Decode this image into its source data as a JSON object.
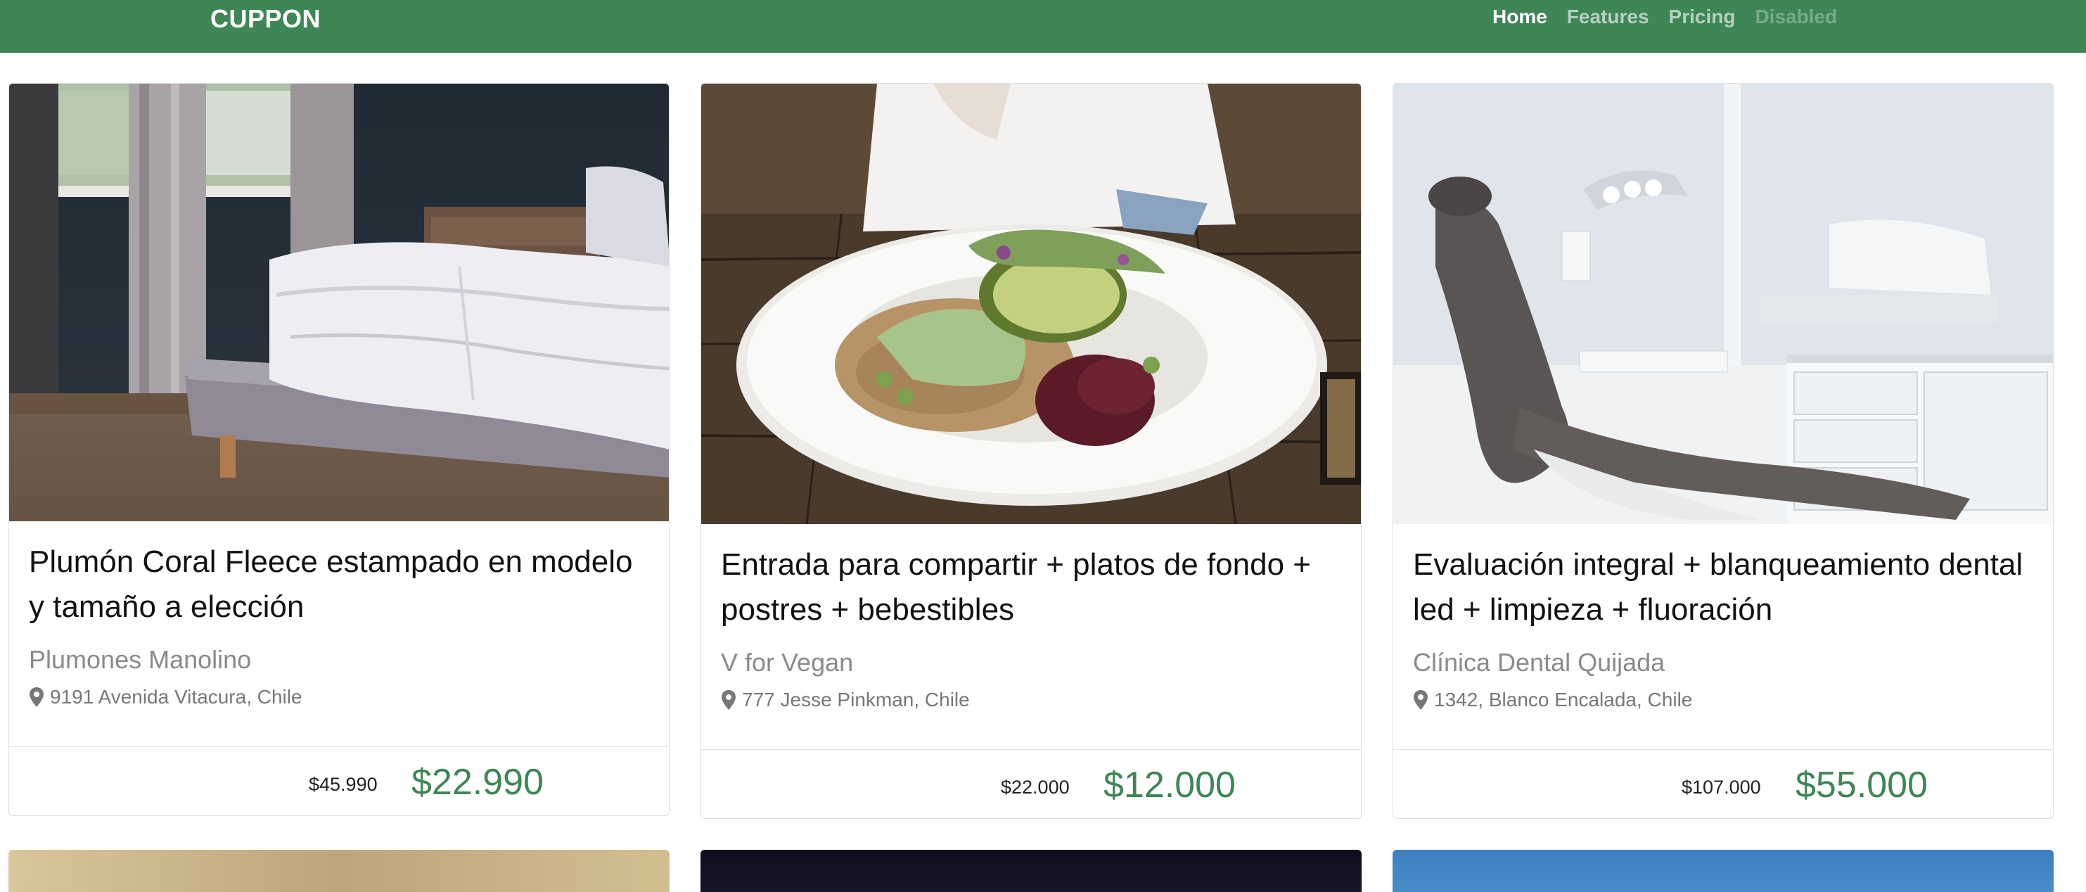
{
  "brand": "CUPPON",
  "nav": {
    "home": "Home",
    "features": "Features",
    "pricing": "Pricing",
    "disabled": "Disabled"
  },
  "colors": {
    "primary": "#3e8656",
    "price": "#3e8656"
  },
  "cards": [
    {
      "title": "Plumón Coral Fleece estampado en modelo y tamaño a elección",
      "merchant": "Plumones Manolino",
      "location": "9191 Avenida Vitacura, Chile",
      "price_old": "$45.990",
      "price_new": "$22.990",
      "icon": "map-marker-icon"
    },
    {
      "title": "Entrada para compartir + platos de fondo + postres + bebestibles",
      "merchant": "V for Vegan",
      "location": "777 Jesse Pinkman, Chile",
      "price_old": "$22.000",
      "price_new": "$12.000",
      "icon": "map-marker-icon"
    },
    {
      "title": "Evaluación integral + blanqueamiento dental led + limpieza + fluoración",
      "merchant": "Clínica Dental Quijada",
      "location": "1342, Blanco Encalada, Chile",
      "price_old": "$107.000",
      "price_new": "$55.000",
      "icon": "map-marker-icon"
    }
  ]
}
